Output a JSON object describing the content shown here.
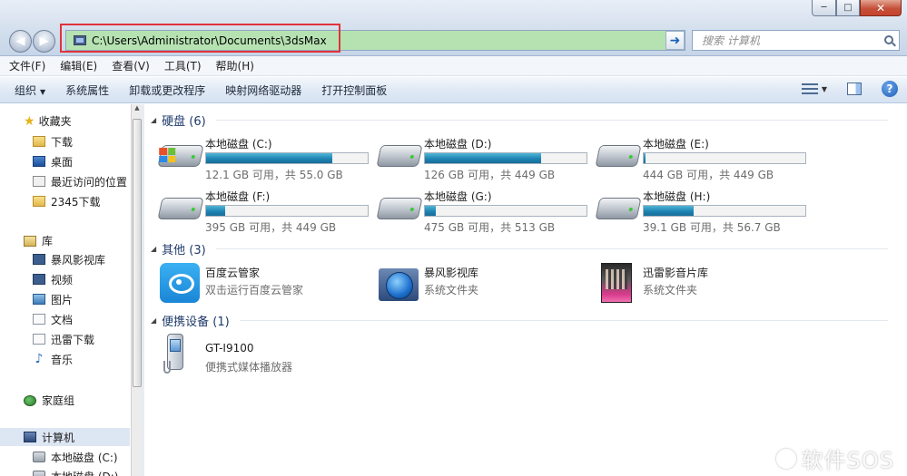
{
  "window": {
    "controls": {
      "minimize": "─",
      "maximize": "□",
      "close": "✕"
    }
  },
  "address": {
    "path": "C:\\Users\\Administrator\\Documents\\3dsMax",
    "highlight_color": "#e0333a"
  },
  "search": {
    "placeholder": "搜索 计算机"
  },
  "menu": [
    "文件(F)",
    "编辑(E)",
    "查看(V)",
    "工具(T)",
    "帮助(H)"
  ],
  "commands": {
    "organize": "组织",
    "items": [
      "系统属性",
      "卸载或更改程序",
      "映射网络驱动器",
      "打开控制面板"
    ]
  },
  "nav": {
    "favorites": {
      "label": "收藏夹",
      "items": [
        "下载",
        "桌面",
        "最近访问的位置",
        "2345下载"
      ]
    },
    "libraries": {
      "label": "库",
      "items": [
        "暴风影视库",
        "视频",
        "图片",
        "文档",
        "迅雷下载",
        "音乐"
      ]
    },
    "homegroup": "家庭组",
    "computer": {
      "label": "计算机",
      "items": [
        "本地磁盘 (C:)",
        "本地磁盘 (D:)"
      ]
    }
  },
  "groups": {
    "hard_disks": "硬盘 (6)",
    "other": "其他 (3)",
    "portable": "便携设备 (1)"
  },
  "drives": [
    {
      "name": "本地磁盘 (C:)",
      "info": "12.1 GB 可用，共 55.0 GB",
      "used_fraction": 0.78
    },
    {
      "name": "本地磁盘 (D:)",
      "info": "126 GB 可用，共 449 GB",
      "used_fraction": 0.72
    },
    {
      "name": "本地磁盘 (E:)",
      "info": "444 GB 可用，共 449 GB",
      "used_fraction": 0.01
    },
    {
      "name": "本地磁盘 (F:)",
      "info": "395 GB 可用，共 449 GB",
      "used_fraction": 0.12
    },
    {
      "name": "本地磁盘 (G:)",
      "info": "475 GB 可用，共 513 GB",
      "used_fraction": 0.07
    },
    {
      "name": "本地磁盘 (H:)",
      "info": "39.1 GB 可用，共 56.7 GB",
      "used_fraction": 0.31
    }
  ],
  "others": [
    {
      "name": "百度云管家",
      "sub": "双击运行百度云管家",
      "icon": "baidu-cloud-icon"
    },
    {
      "name": "暴风影视库",
      "sub": "系统文件夹",
      "icon": "storm-library-icon"
    },
    {
      "name": "迅雷影音片库",
      "sub": "系统文件夹",
      "icon": "thunder-library-icon"
    }
  ],
  "portable": [
    {
      "name": "GT-I9100",
      "sub": "便携式媒体播放器",
      "icon": "phone-icon"
    }
  ],
  "watermark": "软件SOS",
  "colors": {
    "address_bg": "#b6e2b2",
    "bar_fill": "#1f84b3",
    "group_header": "#1e3a6a"
  }
}
